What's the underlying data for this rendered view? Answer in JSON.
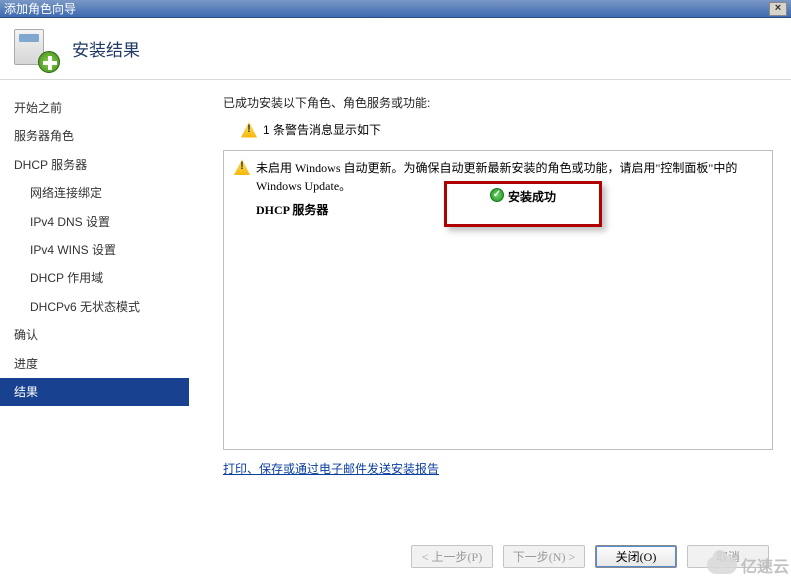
{
  "window": {
    "title": "添加角色向导"
  },
  "header": {
    "title": "安装结果"
  },
  "sidebar": {
    "items": [
      {
        "label": "开始之前",
        "sub": false,
        "sel": false
      },
      {
        "label": "服务器角色",
        "sub": false,
        "sel": false
      },
      {
        "label": "DHCP 服务器",
        "sub": false,
        "sel": false
      },
      {
        "label": "网络连接绑定",
        "sub": true,
        "sel": false
      },
      {
        "label": "IPv4 DNS 设置",
        "sub": true,
        "sel": false
      },
      {
        "label": "IPv4 WINS 设置",
        "sub": true,
        "sel": false
      },
      {
        "label": "DHCP 作用域",
        "sub": true,
        "sel": false
      },
      {
        "label": "DHCPv6 无状态模式",
        "sub": true,
        "sel": false
      },
      {
        "label": "确认",
        "sub": false,
        "sel": false
      },
      {
        "label": "进度",
        "sub": false,
        "sel": false
      },
      {
        "label": "结果",
        "sub": false,
        "sel": true
      }
    ]
  },
  "content": {
    "intro": "已成功安装以下角色、角色服务或功能:",
    "warning_summary": "1 条警告消息显示如下",
    "update_warning": "未启用 Windows 自动更新。为确保自动更新最新安装的角色或功能，请启用\"控制面板\"中的 Windows Update。",
    "role_name": "DHCP 服务器",
    "status_text": "安装成功",
    "link_text": "打印、保存或通过电子邮件发送安装报告"
  },
  "buttons": {
    "back": "< 上一步(P)",
    "next": "下一步(N) >",
    "close": "关闭(O)",
    "cancel": "取消"
  },
  "watermark": "亿速云"
}
